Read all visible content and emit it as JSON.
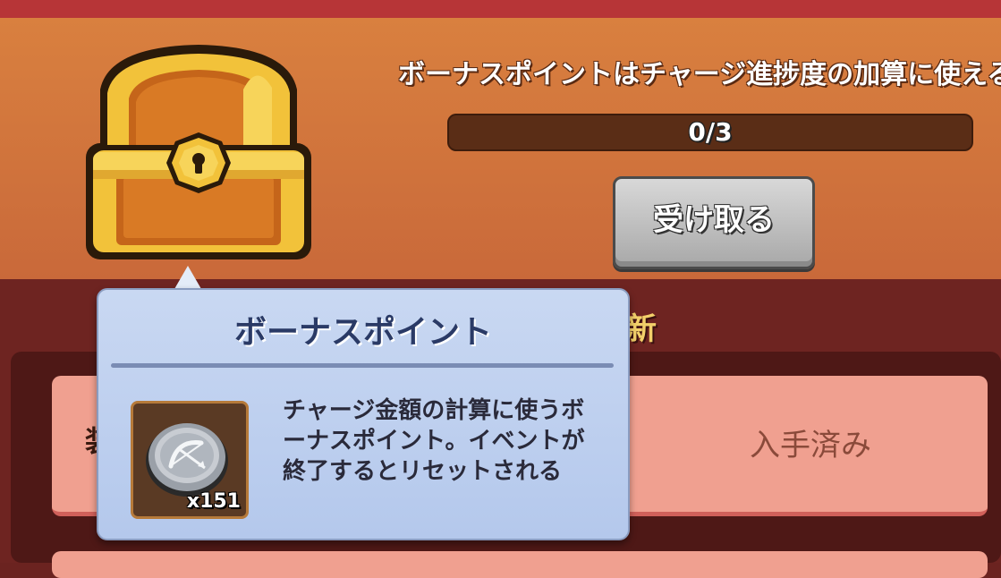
{
  "header": {
    "bonus_info": "ボーナスポイントはチャージ進捗度の加算に使える",
    "progress": {
      "current": 0,
      "total": 3,
      "text": "0/3"
    },
    "claim_button_label": "受け取る"
  },
  "section": {
    "title_fragment": "新"
  },
  "reward_row": {
    "left_fragment": "装",
    "status_label": "入手済み"
  },
  "tooltip": {
    "title": "ボーナスポイント",
    "item_icon": "bow-coin-icon",
    "item_count": "x151",
    "description": "チャージ金額の計算に使うボーナスポイント。イベントが終了するとリセットされる"
  },
  "colors": {
    "header_bg": "#d9803f",
    "tooltip_bg": "#c9d8f2",
    "row_bg": "#f0a090",
    "accent_gold": "#f3d06a"
  }
}
